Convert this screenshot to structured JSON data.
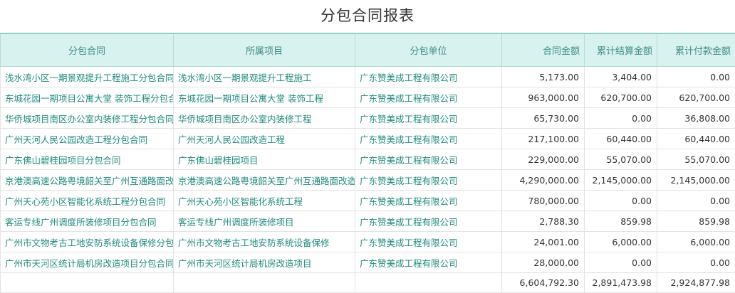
{
  "title": "分包合同报表",
  "columns": {
    "contract": "分包合同",
    "project": "所属项目",
    "unit": "分包单位",
    "amount": "合同金额",
    "settled": "累计结算金额",
    "paid": "累计付款金额"
  },
  "rows": [
    {
      "contract": "浅水湾小区一期景观提升工程施工分包合同",
      "project": "浅水湾小区一期景观提升工程施工",
      "unit": "广东赞美成工程有限公司",
      "amount": "5,173.00",
      "settled": "3,404.00",
      "paid": "0.00"
    },
    {
      "contract": "东城花园一期项目公寓大堂 装饰工程分包合同",
      "project": "东城花园一期项目公寓大堂 装饰工程",
      "unit": "广东赞美成工程有限公司",
      "amount": "963,000.00",
      "settled": "620,700.00",
      "paid": "620,700.00"
    },
    {
      "contract": "华侨城项目南区办公室内装修工程分包合同",
      "project": "华侨城项目南区办公室内装修工程",
      "unit": "广东赞美成工程有限公司",
      "amount": "65,730.00",
      "settled": "0.00",
      "paid": "36,808.00"
    },
    {
      "contract": "广州天河人民公园改造工程分包合同",
      "project": "广州天河人民公园改造工程",
      "unit": "广东赞美成工程有限公司",
      "amount": "217,100.00",
      "settled": "60,440.00",
      "paid": "60,440.00"
    },
    {
      "contract": "广东佛山碧桂园项目分包合同",
      "project": "广东佛山碧桂园项目",
      "unit": "广东赞美成工程有限公司",
      "amount": "229,000.00",
      "settled": "55,070.00",
      "paid": "55,070.00"
    },
    {
      "contract": "京港澳高速公路粤境韶关至广州互通路面改造工程",
      "project": "京港澳高速公路粤境韶关至广州互通路面改造工程",
      "unit": "广东赞美成工程有限公司",
      "amount": "4,290,000.00",
      "settled": "2,145,000.00",
      "paid": "2,145,000.00"
    },
    {
      "contract": "广州天心苑小区智能化系统工程分包合同",
      "project": "广州天心苑小区智能化系统工程",
      "unit": "广东赞美成工程有限公司",
      "amount": "780,000.00",
      "settled": "0.00",
      "paid": "0.00"
    },
    {
      "contract": "客运专线广州调度所装修项目分包合同",
      "project": "客运专线广州调度所装修项目",
      "unit": "广东赞美成工程有限公司",
      "amount": "2,788.30",
      "settled": "859.98",
      "paid": "859.98"
    },
    {
      "contract": "广州市文物考古工地安防系统设备保修分包合同",
      "project": "广州市文物考古工地安防系统设备保修",
      "unit": "广东赞美成工程有限公司",
      "amount": "24,001.00",
      "settled": "6,000.00",
      "paid": "6,000.00"
    },
    {
      "contract": "广州市天河区统计局机房改造项目分包合同",
      "project": "广州市天河区统计局机房改造项目",
      "unit": "广东赞美成工程有限公司",
      "amount": "28,000.00",
      "settled": "0.00",
      "paid": "0.00"
    }
  ],
  "totals": {
    "amount": "6,604,792.30",
    "settled": "2,891,473.98",
    "paid": "2,924,877.98"
  }
}
